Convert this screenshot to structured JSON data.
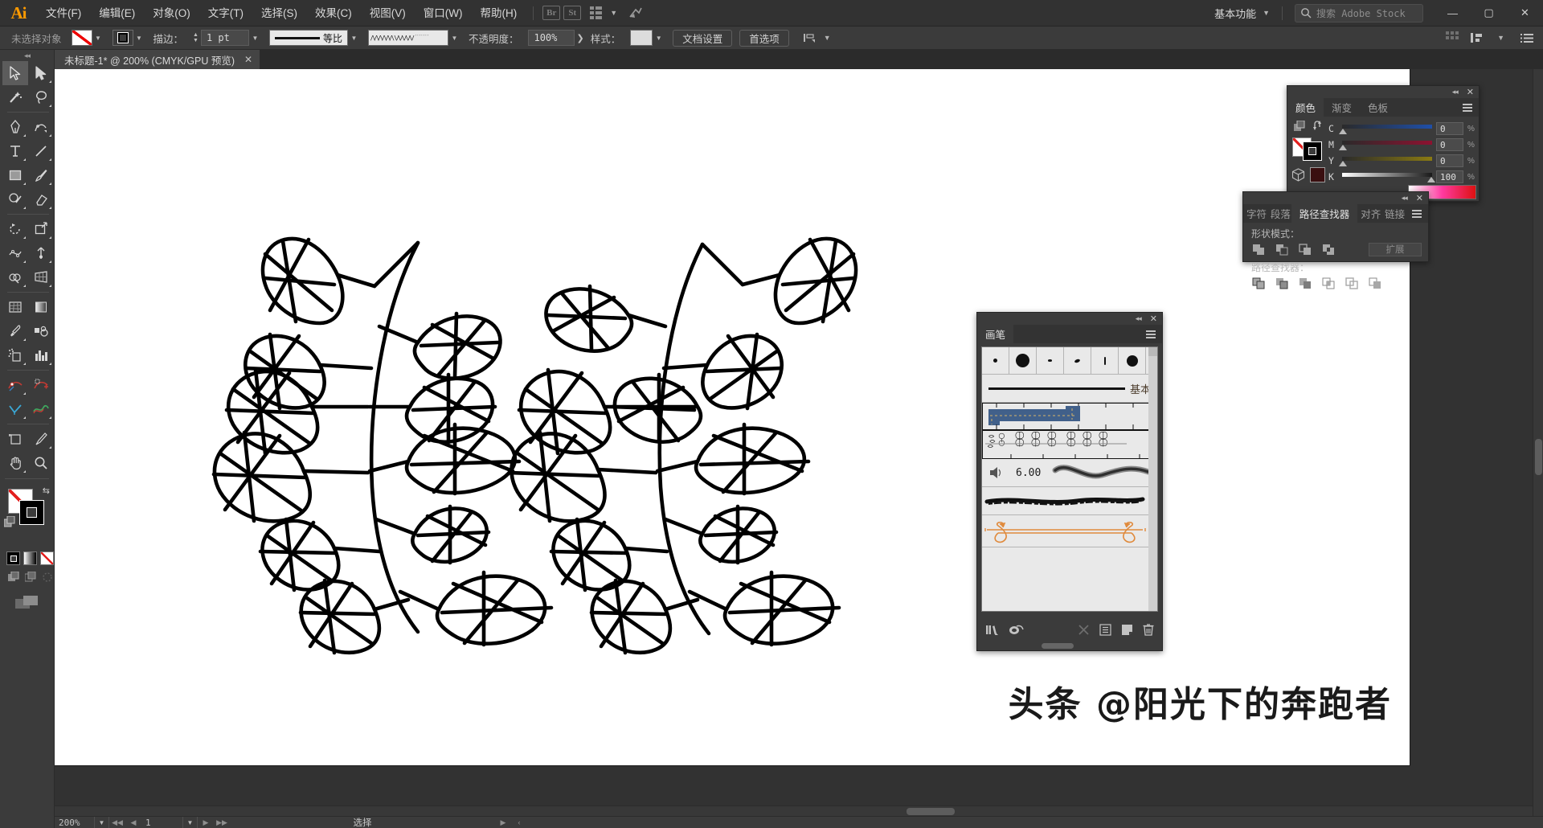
{
  "app": {
    "logo": "Ai",
    "title": "Adobe Illustrator"
  },
  "menubar": {
    "items": [
      {
        "label": "文件(F)",
        "name": "menu-file"
      },
      {
        "label": "编辑(E)",
        "name": "menu-edit"
      },
      {
        "label": "对象(O)",
        "name": "menu-object"
      },
      {
        "label": "文字(T)",
        "name": "menu-type"
      },
      {
        "label": "选择(S)",
        "name": "menu-select"
      },
      {
        "label": "效果(C)",
        "name": "menu-effect"
      },
      {
        "label": "视图(V)",
        "name": "menu-view"
      },
      {
        "label": "窗口(W)",
        "name": "menu-window"
      },
      {
        "label": "帮助(H)",
        "name": "menu-help"
      }
    ],
    "bridge_icon": "Br",
    "stock_icon": "St",
    "arrange_icon": "arrange-documents-icon",
    "workspace": "基本功能",
    "search_placeholder": "搜索 Adobe Stock",
    "minimize": "—",
    "maximize": "▢",
    "close": "✕"
  },
  "controlbar": {
    "selection_label": "未选择对象",
    "fill_swatch": "none",
    "stroke_swatch": "black",
    "stroke_label": "描边：",
    "stroke_weight": "1 pt",
    "profile_label": "等比",
    "brush_definition": "basic-charcoal",
    "opacity_label": "不透明度：",
    "opacity_value": "100%",
    "style_label": "样式：",
    "doc_setup": "文档设置",
    "preferences": "首选项",
    "align_icon": "align-icon"
  },
  "tabbar": {
    "document_tab": "未标题-1* @ 200% (CMYK/GPU 预览)",
    "close_glyph": "✕"
  },
  "toolbar": {
    "tools": [
      {
        "name": "selection-tool",
        "label": "选择工具",
        "active": true
      },
      {
        "name": "direct-selection-tool",
        "label": "直接选择工具"
      },
      {
        "name": "magic-wand-tool",
        "label": "魔棒工具"
      },
      {
        "name": "lasso-tool",
        "label": "套索工具"
      },
      {
        "name": "pen-tool",
        "label": "钢笔工具"
      },
      {
        "name": "curvature-tool",
        "label": "曲率工具"
      },
      {
        "name": "type-tool",
        "label": "文字工具"
      },
      {
        "name": "line-segment-tool",
        "label": "直线段工具"
      },
      {
        "name": "rectangle-tool",
        "label": "矩形工具"
      },
      {
        "name": "paintbrush-tool",
        "label": "画笔工具"
      },
      {
        "name": "shaper-tool",
        "label": "Shaper 工具"
      },
      {
        "name": "eraser-tool",
        "label": "橡皮擦工具"
      },
      {
        "name": "rotate-tool",
        "label": "旋转工具"
      },
      {
        "name": "scale-tool",
        "label": "比例缩放工具"
      },
      {
        "name": "width-tool",
        "label": "宽度工具"
      },
      {
        "name": "free-transform-tool",
        "label": "自由变换工具"
      },
      {
        "name": "shape-builder-tool",
        "label": "形状生成器工具"
      },
      {
        "name": "perspective-grid-tool",
        "label": "透视网格工具"
      },
      {
        "name": "mesh-tool",
        "label": "网格工具"
      },
      {
        "name": "gradient-tool",
        "label": "渐变工具"
      },
      {
        "name": "eyedropper-tool",
        "label": "吸管工具"
      },
      {
        "name": "blend-tool",
        "label": "混合工具"
      },
      {
        "name": "symbol-sprayer-tool",
        "label": "符号喷枪工具"
      },
      {
        "name": "column-graph-tool",
        "label": "柱形图工具"
      },
      {
        "name": "add-anchor-point-tool",
        "label": "添加锚点工具"
      },
      {
        "name": "delete-anchor-point-tool",
        "label": "删除锚点工具"
      },
      {
        "name": "anchor-point-tool",
        "label": "锚点工具"
      },
      {
        "name": "smooth-tool",
        "label": "平滑工具"
      },
      {
        "name": "artboard-tool",
        "label": "画板工具"
      },
      {
        "name": "slice-tool",
        "label": "切片工具"
      },
      {
        "name": "hand-tool",
        "label": "抓手工具"
      },
      {
        "name": "zoom-tool",
        "label": "缩放工具"
      }
    ],
    "fill_label": "填色",
    "stroke_label": "描边",
    "color_mode": "颜色",
    "gradient_mode": "渐变",
    "none_mode": "无",
    "draw_normal": "正常绘图",
    "draw_behind": "背面绘图",
    "draw_inside": "内部绘图",
    "screen_mode": "更改屏幕模式"
  },
  "canvas": {
    "artwork_name": "leaf-branch-artwork",
    "watermark": "头条 @阳光下的奔跑者"
  },
  "statusbar": {
    "zoom": "200%",
    "page": "1",
    "status_text": "选择",
    "first_glyph": "◀◀",
    "prev_glyph": "◀",
    "next_glyph": "▶",
    "last_glyph": "▶▶"
  },
  "color_panel": {
    "tabs": [
      {
        "label": "颜色",
        "name": "tab-color",
        "active": true
      },
      {
        "label": "渐变",
        "name": "tab-gradient",
        "active": false
      },
      {
        "label": "色板",
        "name": "tab-swatches",
        "active": false
      }
    ],
    "sliders": [
      {
        "channel": "C",
        "value": "0",
        "unit": "%",
        "bar_from": "#2a2a2a",
        "bar_to": "#1f4fa8"
      },
      {
        "channel": "M",
        "value": "0",
        "unit": "%",
        "bar_from": "#2a2a2a",
        "bar_to": "#8d1230"
      },
      {
        "channel": "Y",
        "value": "0",
        "unit": "%",
        "bar_from": "#2a2a2a",
        "bar_to": "#8a7a12"
      },
      {
        "channel": "K",
        "value": "100",
        "unit": "%",
        "bar_from": "#ffffff",
        "bar_to": "#1a1a1a"
      }
    ],
    "collapse_glyph": "◂◂",
    "close_glyph": "✕"
  },
  "pathfinder_panel": {
    "tabs": [
      {
        "label": "字符",
        "name": "tab-character",
        "active": false
      },
      {
        "label": "段落",
        "name": "tab-paragraph",
        "active": false
      },
      {
        "label": "路径查找器",
        "name": "tab-pathfinder",
        "active": true
      },
      {
        "label": "对齐",
        "name": "tab-align",
        "active": false
      },
      {
        "label": "链接",
        "name": "tab-links",
        "active": false
      }
    ],
    "shape_modes_label": "形状模式：",
    "pathfinders_label": "路径查找器：",
    "expand_label": "扩展",
    "shape_modes": [
      "unite",
      "minus-front",
      "intersect",
      "exclude"
    ],
    "pathfinders": [
      "divide",
      "trim",
      "merge",
      "crop",
      "outline",
      "minus-back"
    ],
    "collapse_glyph": "◂◂",
    "close_glyph": "✕"
  },
  "brushes_panel": {
    "tab_label": "画笔",
    "basic_label": "基本",
    "size_value": "6.00",
    "collapse_glyph": "◂◂",
    "close_glyph": "✕",
    "footer_icons": [
      {
        "name": "brush-libraries-icon",
        "enabled": true
      },
      {
        "name": "libraries-icon",
        "enabled": true
      },
      {
        "name": "remove-brush-stroke-icon",
        "enabled": false
      },
      {
        "name": "brush-options-icon",
        "enabled": true
      },
      {
        "name": "new-brush-icon",
        "enabled": true
      },
      {
        "name": "delete-brush-icon",
        "enabled": true
      }
    ],
    "brush_rows": [
      {
        "name": "calligraphic-brushes",
        "type": "swatch-row"
      },
      {
        "name": "basic-stroke",
        "type": "basic"
      },
      {
        "name": "pattern-brush-denim",
        "type": "pattern",
        "selected": true
      },
      {
        "name": "pattern-brush-leaves",
        "type": "pattern",
        "selected": true
      },
      {
        "name": "bristle-brush",
        "type": "bristle",
        "size": "6.00"
      },
      {
        "name": "charcoal-art-brush",
        "type": "art"
      },
      {
        "name": "arrow-pattern-brush",
        "type": "arrow"
      }
    ]
  },
  "colors": {
    "accent": "#ff9a00",
    "panel_bg": "#3b3b3b",
    "chrome_bg": "#323232",
    "canvas_bg": "#ffffff",
    "artwork_stroke": "#000000"
  }
}
